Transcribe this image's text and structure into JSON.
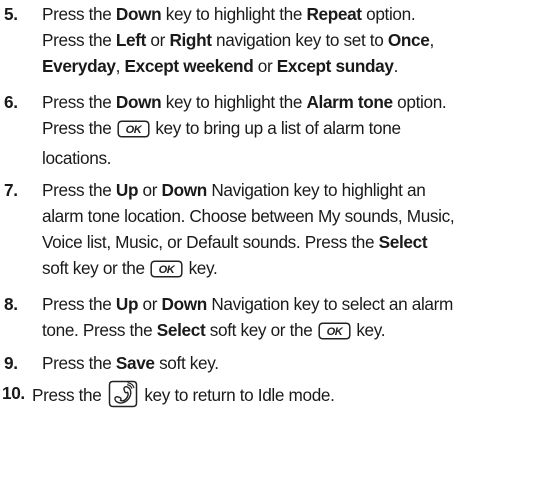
{
  "steps": [
    {
      "number": "5.",
      "line1": [
        "Press the ",
        "Down",
        " key to highlight the ",
        "Repeat",
        " option."
      ],
      "line2": [
        "Press the ",
        "Left",
        " or ",
        "Right",
        " navigation key to set to ",
        "Once",
        ","
      ],
      "line3": [
        "Everyday",
        ", ",
        "Except weekend",
        " or ",
        "Except sunday",
        "."
      ]
    },
    {
      "number": "6.",
      "line1": [
        "Press the ",
        "Down",
        " key to highlight the ",
        "Alarm tone",
        " option."
      ],
      "line2": [
        "Press the ",
        " key to bring up a list of alarm tone"
      ],
      "line3": [
        "locations."
      ]
    },
    {
      "number": "7.",
      "line1": [
        "Press the ",
        "Up",
        " or ",
        "Down",
        " Navigation key to highlight an"
      ],
      "line2": [
        "alarm tone location. Choose between My sounds, Music,"
      ],
      "line3": [
        "Voice list, Music, or Default sounds. Press the ",
        "Select"
      ],
      "line4": [
        "soft key or the ",
        " key."
      ]
    },
    {
      "number": "8.",
      "line1": [
        "Press the ",
        "Up",
        " or ",
        "Down",
        " Navigation key to select an alarm"
      ],
      "line2": [
        "tone. Press the ",
        "Select",
        " soft key or the ",
        " key."
      ]
    },
    {
      "number": "9.",
      "line1": [
        "Press the ",
        "Save",
        " soft key."
      ]
    },
    {
      "number": "10.",
      "line1": [
        "Press the ",
        " key to return to Idle mode."
      ]
    }
  ],
  "icons": {
    "ok_key_label": "OK",
    "ok_key_icon": "ok-key-icon",
    "send_key_icon": "send-key-icon"
  }
}
